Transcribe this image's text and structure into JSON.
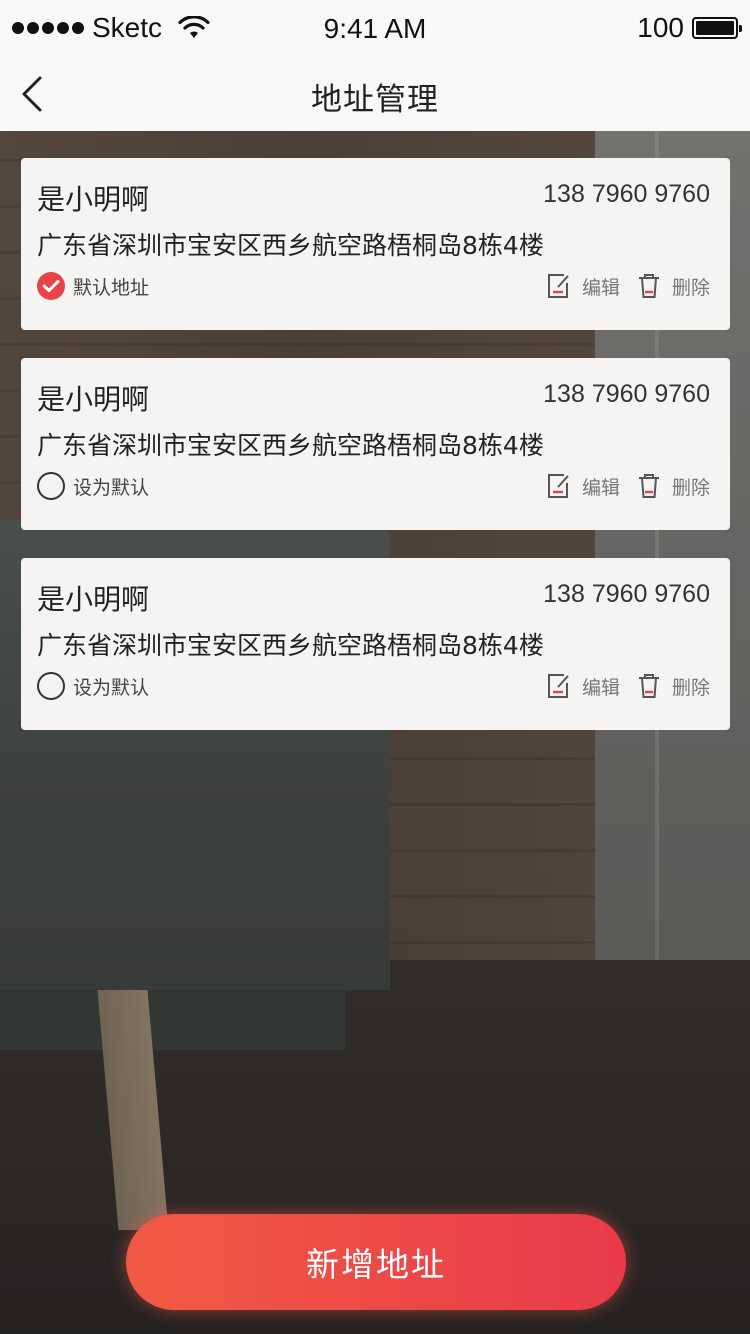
{
  "status_bar": {
    "carrier": "Sketc",
    "time": "9:41 AM",
    "battery": "100",
    "icons": [
      "signal-dots-icon",
      "wifi-icon",
      "battery-icon"
    ]
  },
  "nav": {
    "title": "地址管理",
    "back_icon": "chevron-left-icon"
  },
  "addresses": [
    {
      "name": "是小明啊",
      "phone": "138 7960 9760",
      "address": "广东省深圳市宝安区西乡航空路梧桐岛8栋4楼",
      "is_default": true,
      "default_label": "默认地址",
      "edit_label": "编辑",
      "delete_label": "删除"
    },
    {
      "name": "是小明啊",
      "phone": "138 7960 9760",
      "address": "广东省深圳市宝安区西乡航空路梧桐岛8栋4楼",
      "is_default": false,
      "default_label": "设为默认",
      "edit_label": "编辑",
      "delete_label": "删除"
    },
    {
      "name": "是小明啊",
      "phone": "138 7960 9760",
      "address": "广东省深圳市宝安区西乡航空路梧桐岛8栋4楼",
      "is_default": false,
      "default_label": "设为默认",
      "edit_label": "编辑",
      "delete_label": "删除"
    }
  ],
  "add_button": {
    "label": "新增地址"
  },
  "colors": {
    "accent": "#e8434b",
    "button_gradient_start": "#f05a44",
    "button_gradient_end": "#ea3a4a",
    "card_bg": "#f5f4f2",
    "bar_bg": "#f8f8f8"
  }
}
